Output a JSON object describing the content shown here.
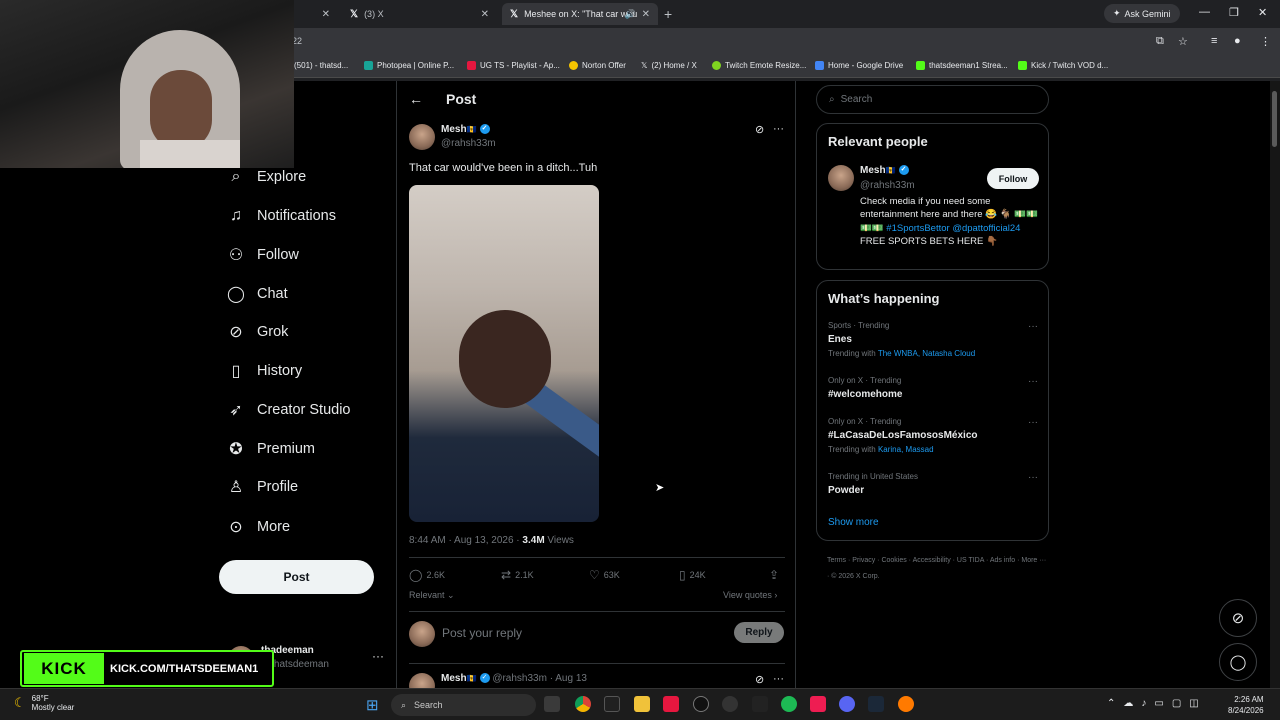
{
  "browser": {
    "tabs": [
      {
        "title": "(3) X",
        "icon": "x-logo-icon"
      },
      {
        "title": "Meshee on X: \"That car wou",
        "icon": "x-logo-icon"
      }
    ],
    "tab_close_glyph": "✕",
    "new_tab_glyph": "+",
    "gemini_label": "Ask Gemini",
    "url_fragment": "22",
    "bookmarks": [
      {
        "label": "(501) - thatsd...",
        "color": "#ff0000"
      },
      {
        "label": "Photopea | Online P...",
        "color": "#18a497"
      },
      {
        "label": "UG TS - Playlist - Ap...",
        "color": "#e6173f"
      },
      {
        "label": "Norton Offer",
        "color": "#f5c400"
      },
      {
        "label": "(2) Home / X",
        "color": "#ffffff"
      },
      {
        "label": "Twitch Emote Resize...",
        "color": "#7fd320"
      },
      {
        "label": "Home - Google Drive",
        "color": "#4285f4"
      },
      {
        "label": "thatsdeeman1 Strea...",
        "color": "#53fc18"
      },
      {
        "label": "Kick / Twitch VOD d...",
        "color": "#53fc18"
      }
    ]
  },
  "nav": {
    "items": [
      {
        "label": "Explore",
        "icon": "search-icon",
        "glyph": "⌕"
      },
      {
        "label": "Notifications",
        "icon": "bell-icon",
        "glyph": "🔔"
      },
      {
        "label": "Follow",
        "icon": "add-person-icon",
        "glyph": "👤"
      },
      {
        "label": "Chat",
        "icon": "chat-bubble-icon",
        "glyph": "◯"
      },
      {
        "label": "Grok",
        "icon": "grok-icon",
        "glyph": "⊘"
      },
      {
        "label": "History",
        "icon": "bookmark-icon",
        "glyph": "🔖"
      },
      {
        "label": "Creator Studio",
        "icon": "rocket-icon",
        "glyph": "🚀"
      },
      {
        "label": "Premium",
        "icon": "verified-badge-icon",
        "glyph": "✓"
      },
      {
        "label": "Profile",
        "icon": "person-icon",
        "glyph": "👤"
      },
      {
        "label": "More",
        "icon": "more-circle-icon",
        "glyph": "⊙"
      }
    ],
    "post_button": "Post",
    "account": {
      "name": "thadeeman",
      "handle": "@thatsdeeman",
      "more": "···"
    }
  },
  "overlay": {
    "kick_logo": "KICK",
    "kick_url": "KICK.COM/THATSDEEMAN1"
  },
  "post": {
    "header": "Post",
    "author_name": "Mesh",
    "author_flag": "🇧🇧",
    "author_handle": "@rahsh33m",
    "text": "That car would've been in a ditch...Tuh",
    "time": "8:44 AM · Aug 13, 2026 · ",
    "views": "3.4M",
    "views_label": " Views",
    "stats": {
      "replies": "2.6K",
      "reposts": "2.1K",
      "likes": "63K",
      "bookmarks": "24K"
    },
    "sort": "Relevant",
    "view_quotes": "View quotes",
    "reply_placeholder": "Post your reply",
    "reply_button": "Reply",
    "next_post": {
      "name": "Mesh",
      "handle_date": "@rahsh33m · Aug 13"
    }
  },
  "sidebar": {
    "search_placeholder": "Search",
    "relevant": {
      "title": "Relevant people",
      "name": "Mesh",
      "handle": "@rahsh33m",
      "follow": "Follow",
      "bio_1": "Check media if you need some entertainment here and there 😂 🐐",
      "bio_money": "💵💵💵💵 ",
      "bio_tag": "#1SportsBettor",
      "bio_mention": "@dpattofficial24",
      "bio_2": " FREE SPORTS BETS HERE 👇🏾"
    },
    "happening": {
      "title": "What’s happening",
      "trends": [
        {
          "meta": "Sports · Trending",
          "title": "Enes",
          "with_prefix": "Trending with ",
          "with": "The WNBA, Natasha Cloud"
        },
        {
          "meta": "Only on X · Trending",
          "title": "#welcomehome",
          "with_prefix": "",
          "with": ""
        },
        {
          "meta": "Only on X · Trending",
          "title": "#LaCasaDeLosFamososMéxico",
          "with_prefix": "Trending with ",
          "with": "Karina, Massad"
        },
        {
          "meta": "Trending in United States",
          "title": "Powder",
          "with_prefix": "",
          "with": ""
        }
      ],
      "show_more": "Show more"
    },
    "footer": "Terms · Privacy · Cookies · Accessibility · US TIDA · Ads info · More ··· · © 2026 X Corp."
  },
  "taskbar": {
    "temp": "68°F",
    "condition": "Mostly clear",
    "search": "Search",
    "time": "2:26 AM",
    "date": "8/24/2026"
  }
}
